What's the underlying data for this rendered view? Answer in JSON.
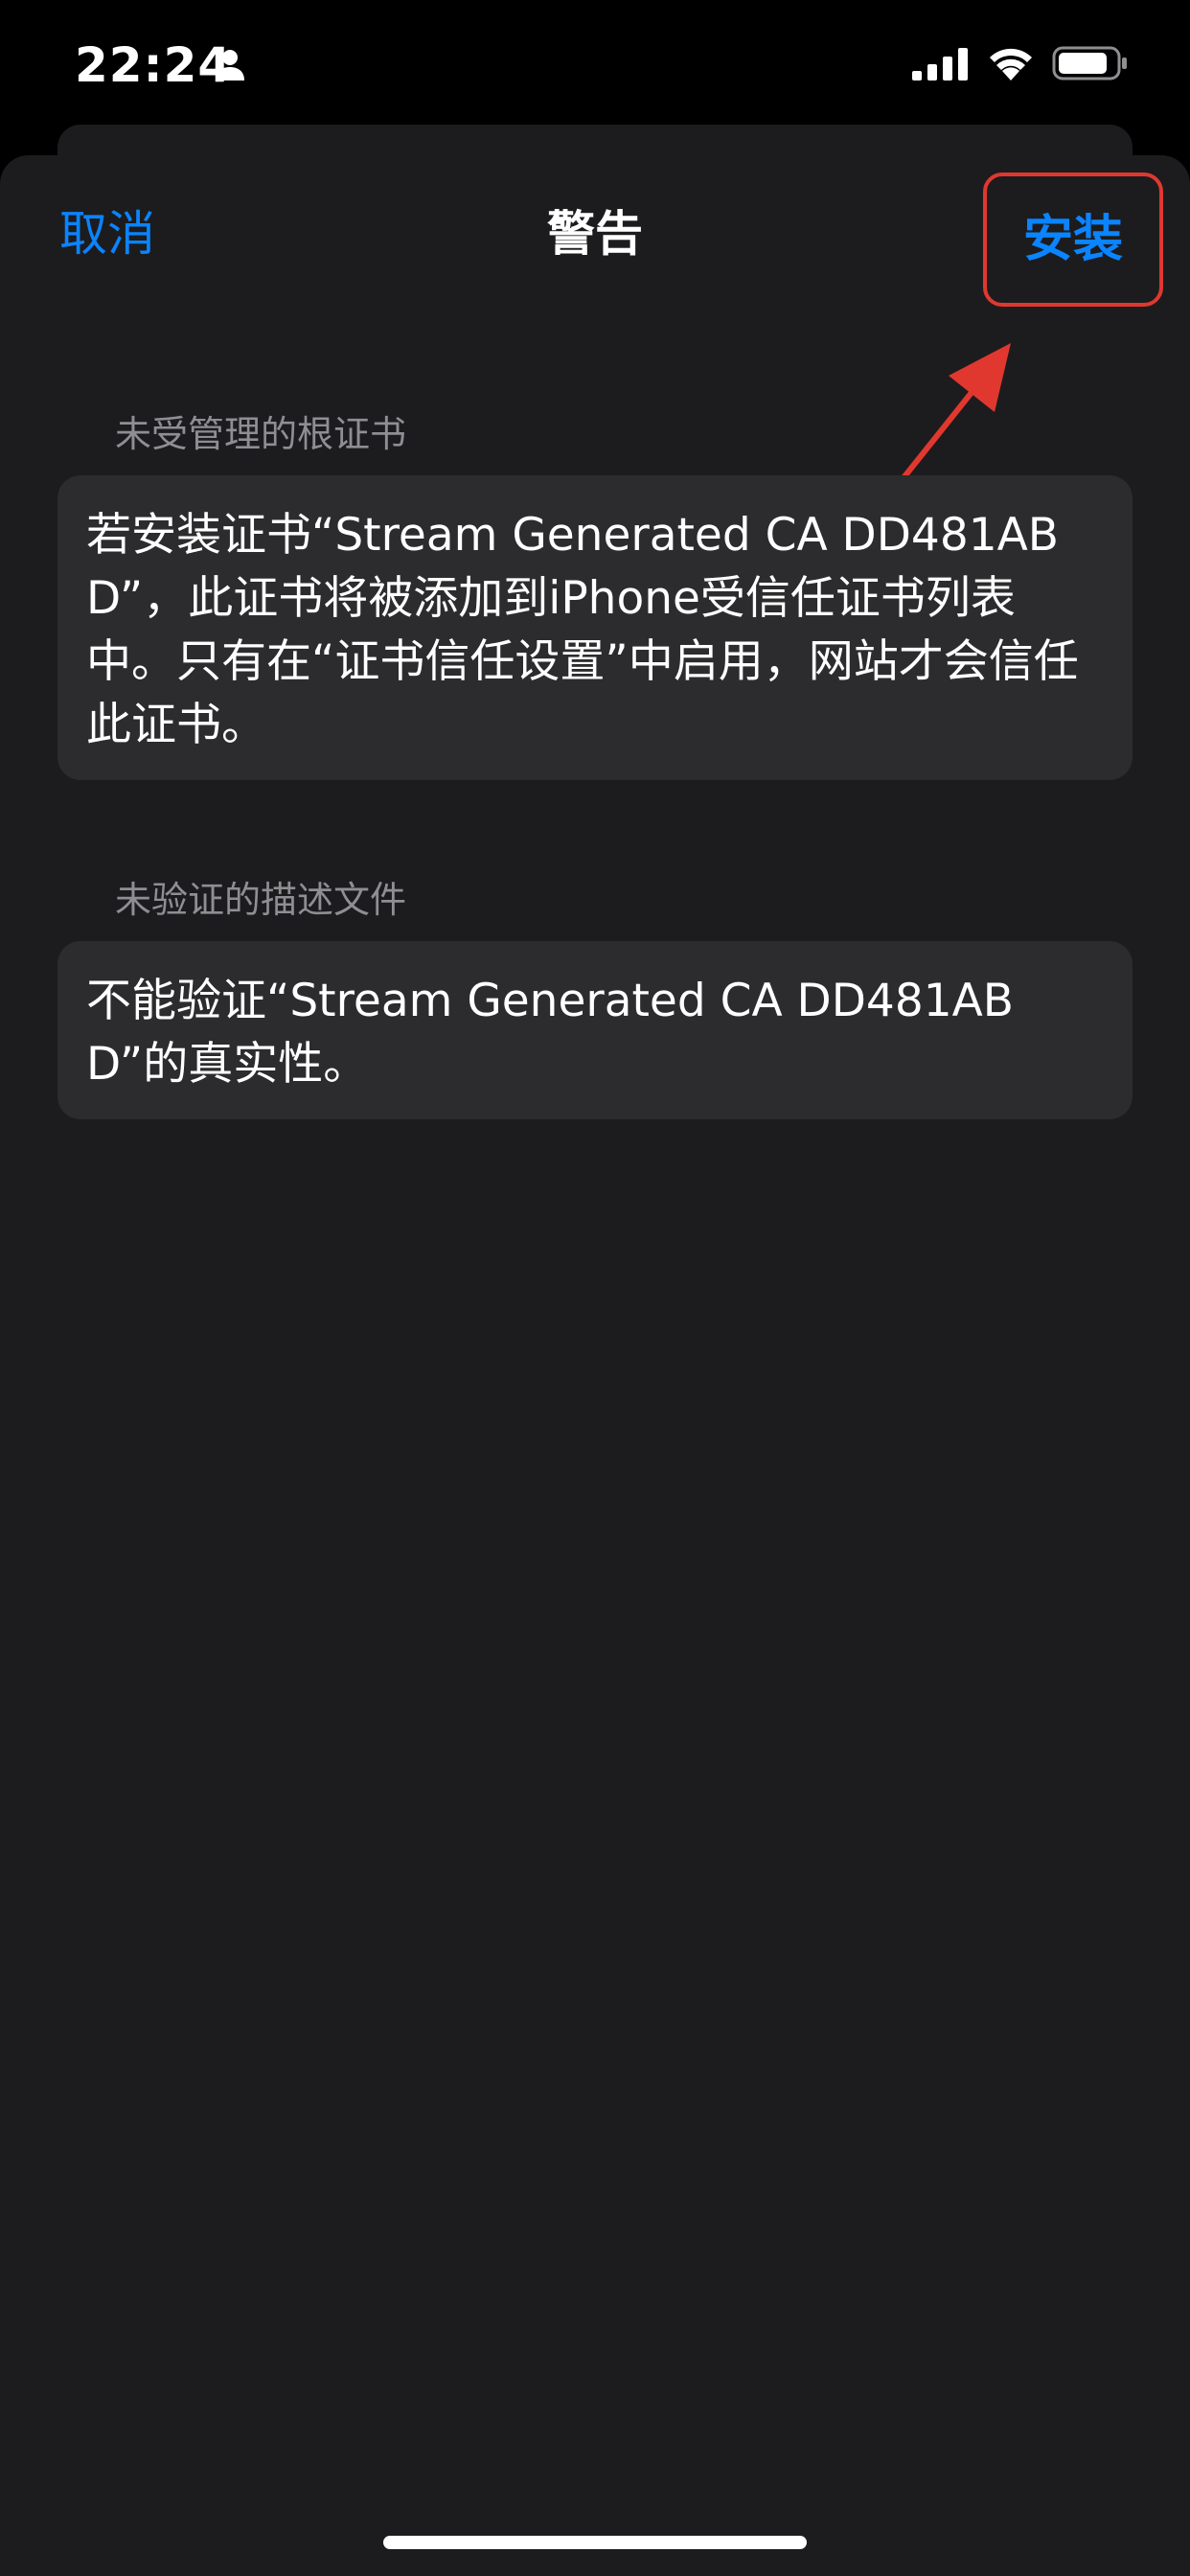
{
  "status_bar": {
    "time": "22:24",
    "icons": [
      "person-icon",
      "cellular-signal-icon",
      "wifi-icon",
      "battery-icon"
    ]
  },
  "nav": {
    "cancel_label": "取消",
    "title": "警告",
    "install_label": "安装"
  },
  "sections": [
    {
      "header": "未受管理的根证书",
      "body": "若安装证书“Stream Generated CA DD481ABD”，此证书将被添加到iPhone受信任证书列表中。只有在“证书信任设置”中启用，网站才会信任此证书。"
    },
    {
      "header": "未验证的描述文件",
      "body": "不能验证“Stream Generated CA DD481ABD”的真实性。"
    }
  ],
  "colors": {
    "accent": "#0a84ff",
    "sheet_background": "#1c1c1e",
    "card_background": "#2c2c2e",
    "secondary_text": "#8e8e93",
    "annotation_red": "#e0382f"
  }
}
